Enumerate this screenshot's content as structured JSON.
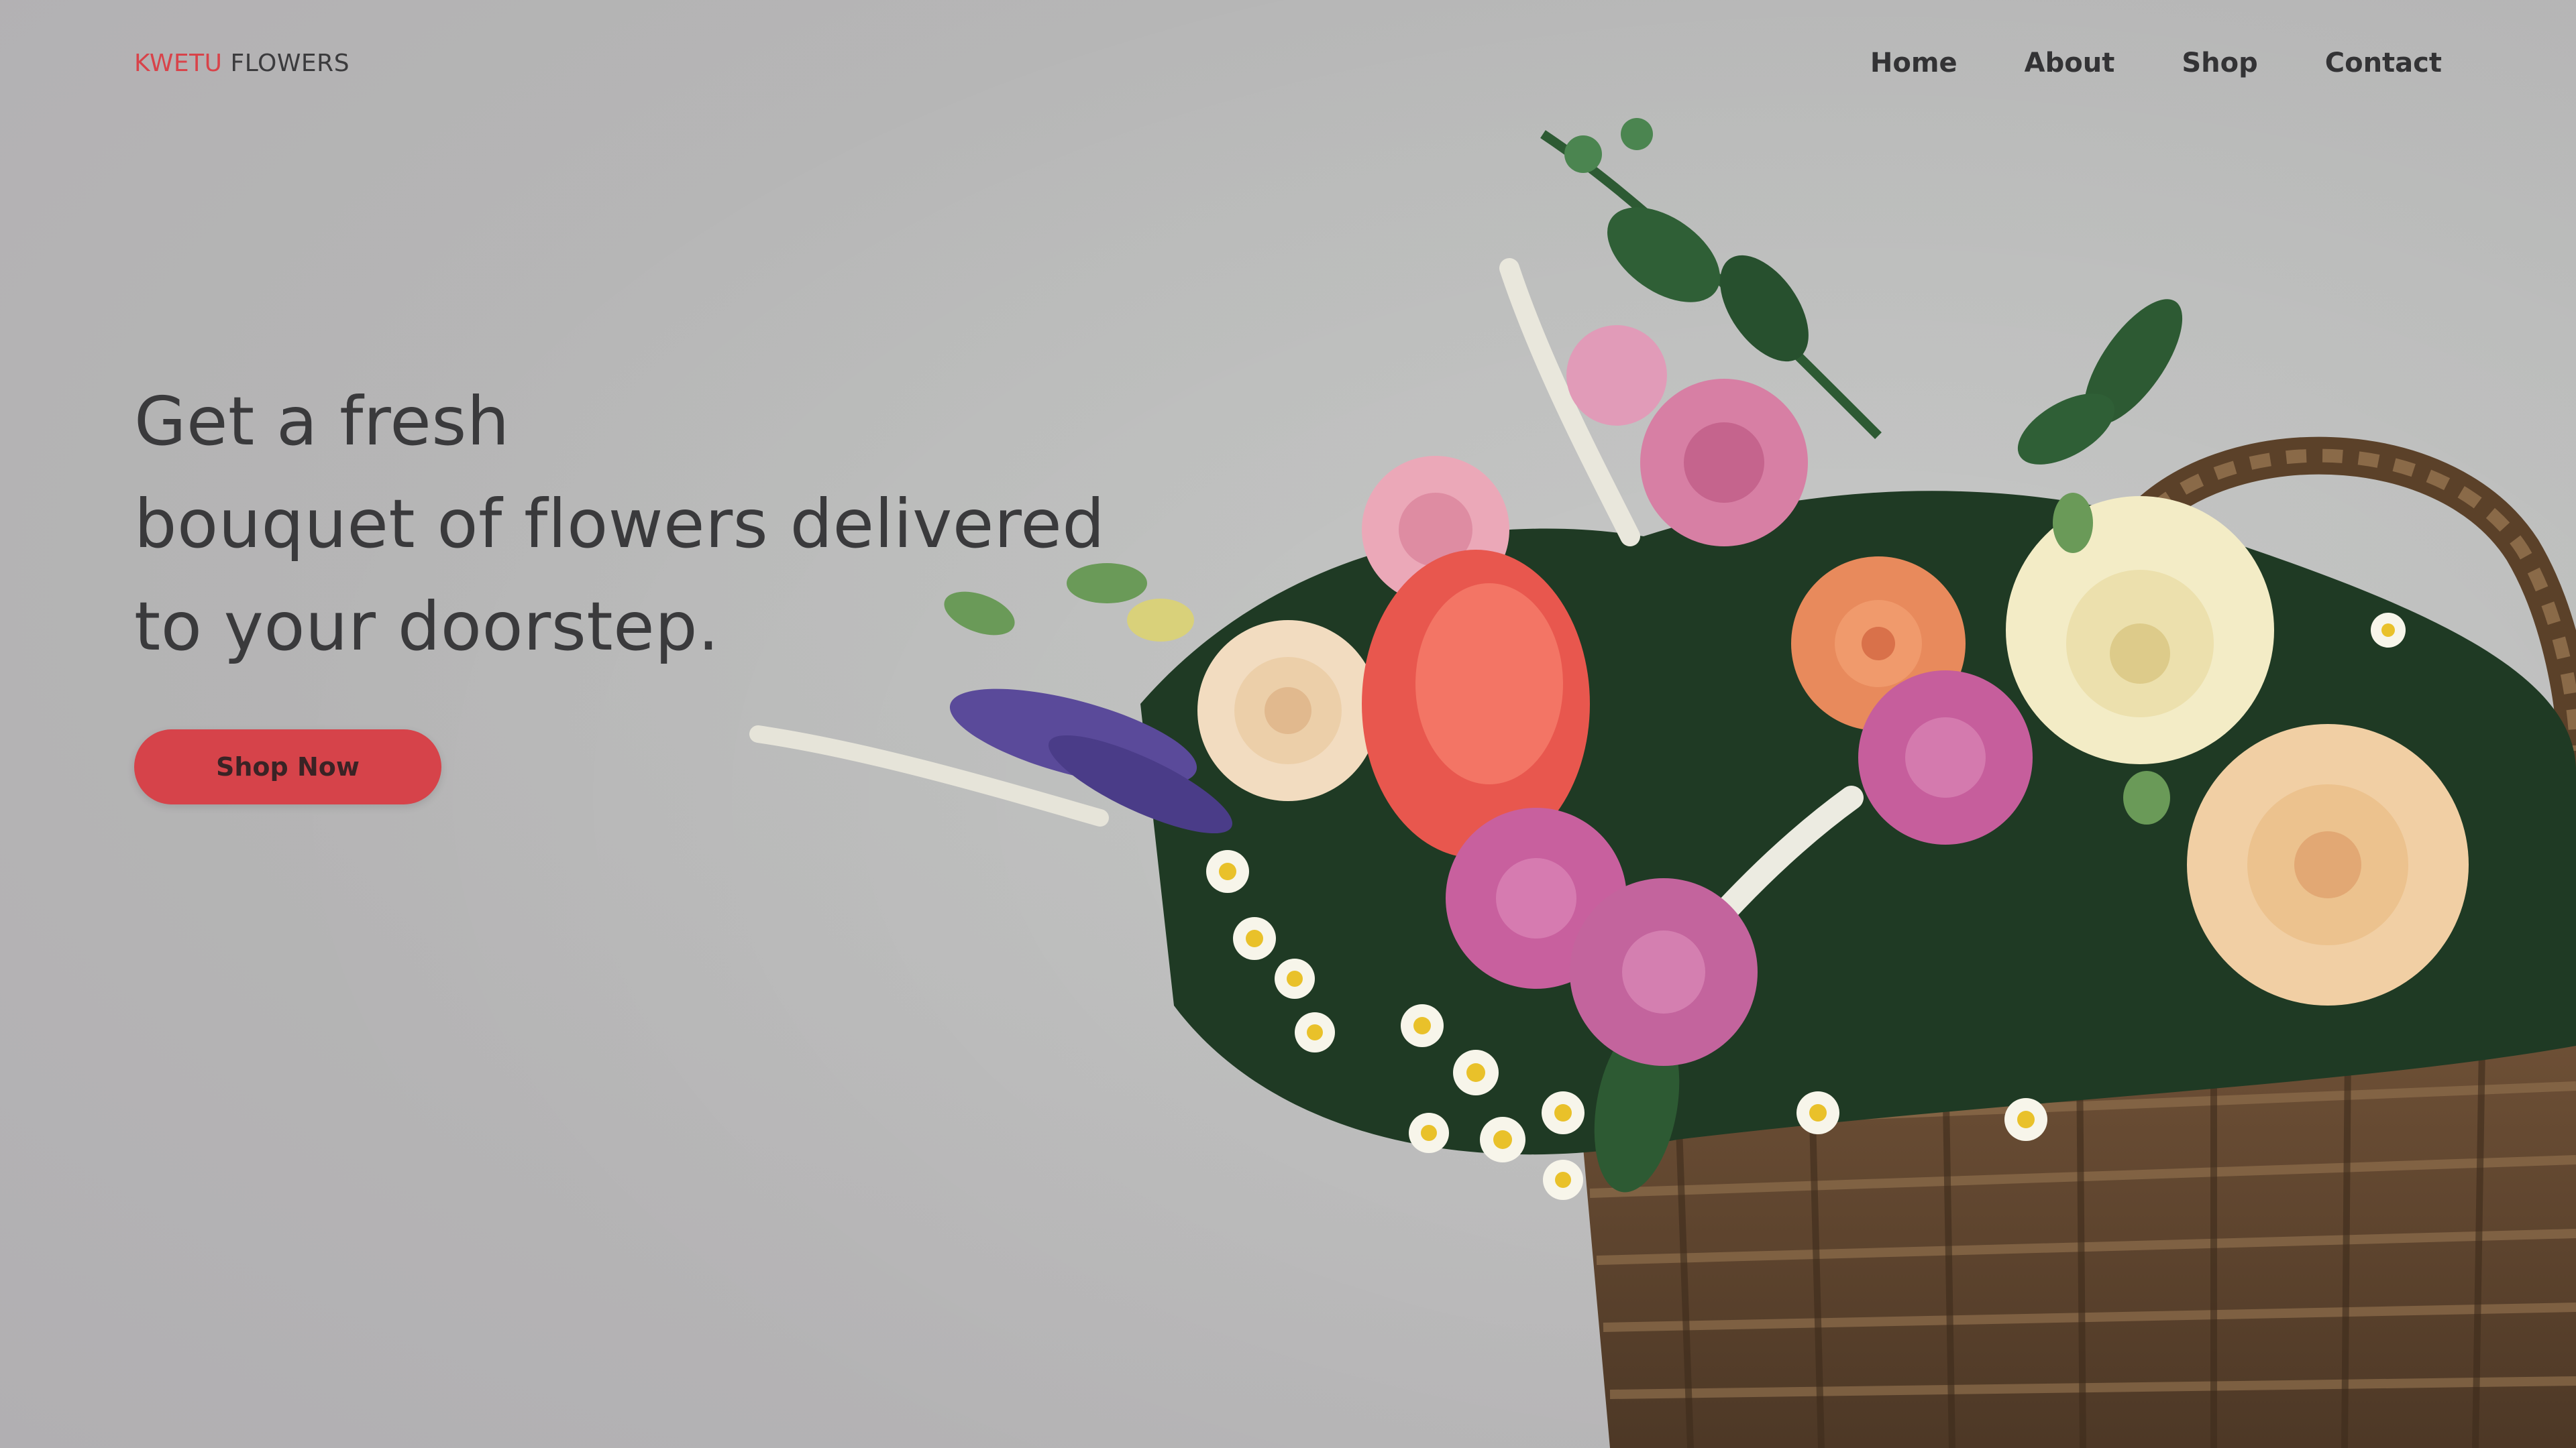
{
  "header": {
    "logo_accent": "KWETU",
    "logo_rest": "FLOWERS",
    "nav": [
      "Home",
      "About",
      "Shop",
      "Contact"
    ]
  },
  "hero": {
    "headline": [
      "Get a fresh",
      "bouquet of flowers delivered",
      "to your doorstep."
    ],
    "cta_label": "Shop Now"
  },
  "colors": {
    "accent": "#d6434a",
    "text": "#3a3a3c",
    "background": "#c4c5c4"
  },
  "image": {
    "subject": "flower-bouquet-in-wicker-basket"
  }
}
